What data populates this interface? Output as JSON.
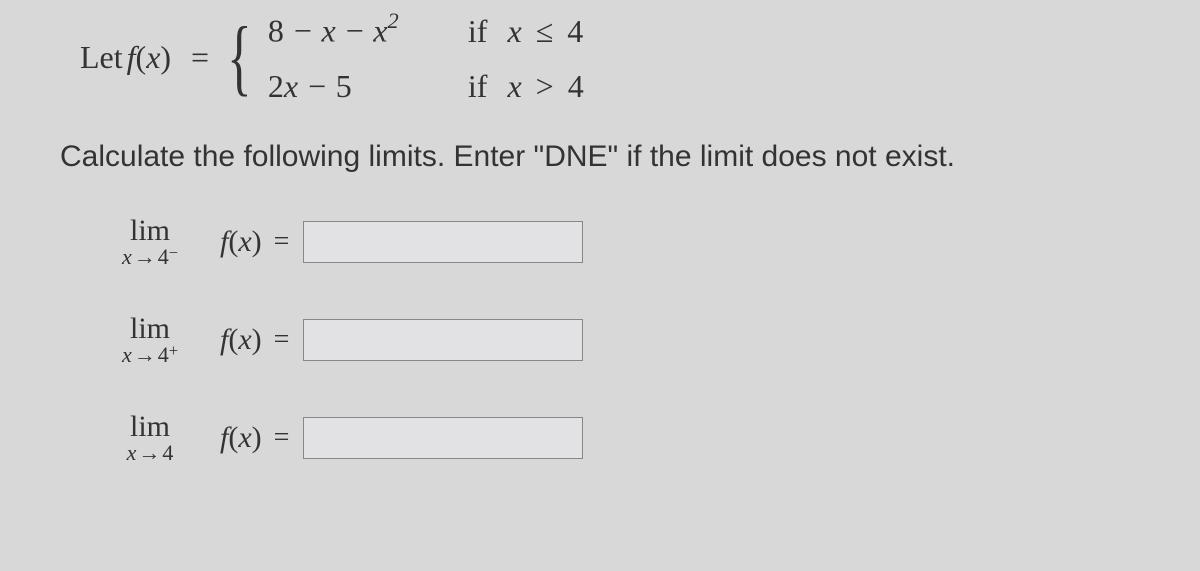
{
  "function_def": {
    "let": "Let",
    "fx": "f(x)",
    "eq": "=",
    "case1_expr": "8 − x − x",
    "case1_sup": "2",
    "case1_if": "if",
    "case1_cond_var": "x",
    "case1_cond_op": "≤",
    "case1_cond_val": "4",
    "case2_expr": "2x − 5",
    "case2_if": "if",
    "case2_cond_var": "x",
    "case2_cond_op": ">",
    "case2_cond_val": "4"
  },
  "instruction": "Calculate the following limits. Enter \"DNE\" if the limit does not exist.",
  "limits": {
    "lim_label": "lim",
    "sub_var": "x",
    "arrow": "→",
    "sub_val": "4",
    "minus_sign": "−",
    "plus_sign": "+",
    "fx": "f(x)",
    "eq": "="
  },
  "answers": {
    "left": "",
    "right": "",
    "two_sided": ""
  }
}
